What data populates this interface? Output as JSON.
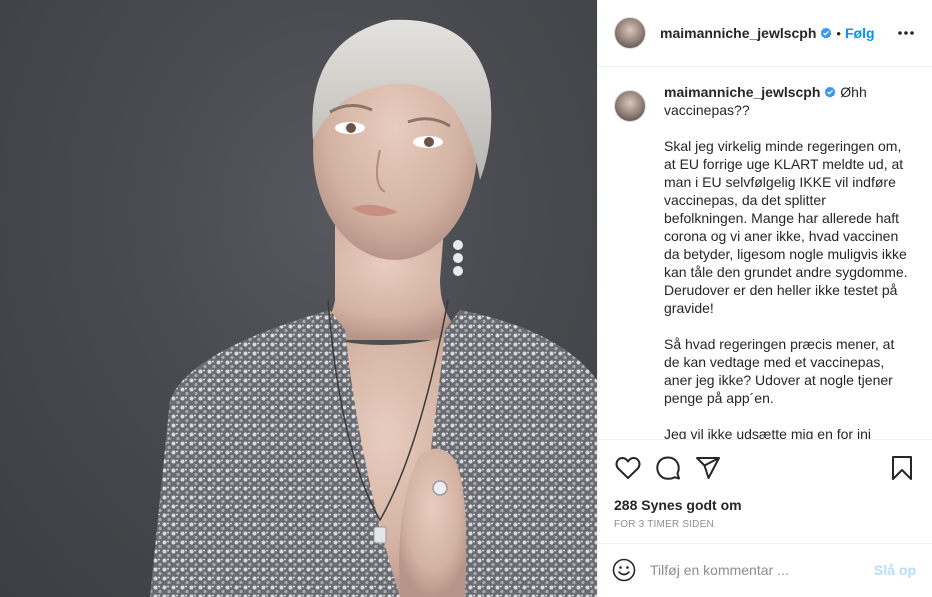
{
  "photo": {
    "alt_subject": "portrait"
  },
  "header": {
    "username": "maimanniche_jewlscph",
    "separator": "•",
    "follow_label": "Følg",
    "icons": {
      "verified": "verified-badge-icon",
      "more": "more-options-icon"
    }
  },
  "caption": {
    "username": "maimanniche_jewlscph",
    "text": " Øhh\nvaccinepas??\n\nSkal jeg virkelig minde regeringen om, at EU forrige uge KLART meldte ud, at man i EU selvfølgelig IKKE vil indføre vaccinepas, da det splitter befolkningen. Mange har allerede haft corona og vi aner ikke, hvad vaccinen da betyder, ligesom nogle muligvis ikke kan tåle den grundet andre sygdomme. Derudover er den heller ikke testet på gravide!\n\nSå hvad regeringen præcis mener, at de kan vedtage med et vaccinepas, aner jeg ikke? Udover at nogle tjener penge på app´en.\n\nJeg vil ikke udsætte mig en for inj"
  },
  "actions": {
    "icons": [
      "heart-icon",
      "comment-icon",
      "share-icon",
      "bookmark-icon"
    ]
  },
  "likes": {
    "text": "288 Synes godt om"
  },
  "timestamp": {
    "text": "FOR 3 TIMER SIDEN"
  },
  "comment_box": {
    "placeholder": "Tilføj en kommentar ...",
    "post_label": "Slå op",
    "icon": "emoji-icon"
  },
  "colors": {
    "accent": "#0095f6",
    "post_disabled": "#b2dffc",
    "text": "#262626",
    "secondary": "#8e8e8e",
    "border": "#efefef"
  }
}
